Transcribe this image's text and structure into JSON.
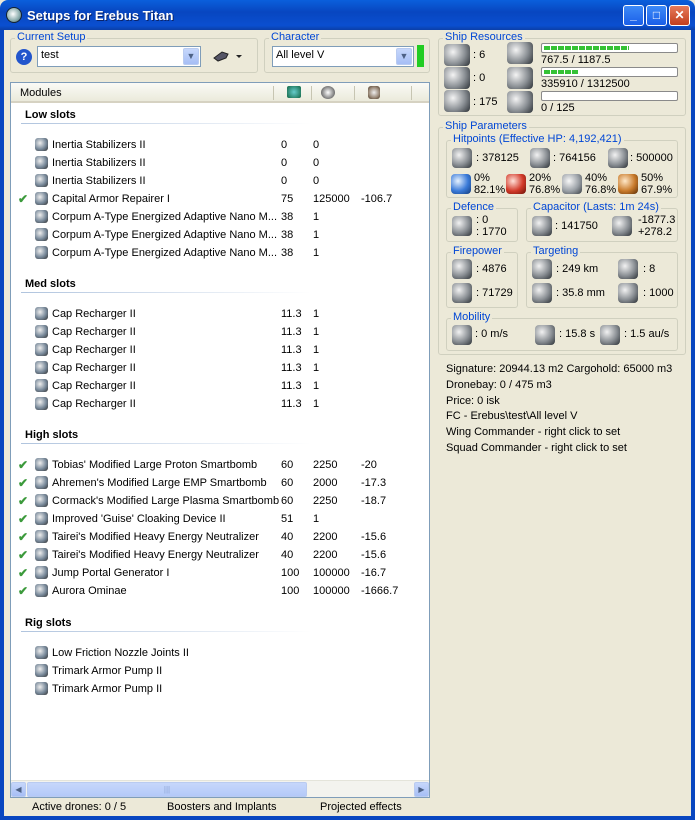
{
  "window": {
    "title": "Setups for Erebus Titan"
  },
  "current_setup": {
    "label": "Current Setup",
    "value": "test"
  },
  "character": {
    "label": "Character",
    "value": "All level V",
    "status_color": "#22cc22"
  },
  "modules_header": {
    "label": "Modules"
  },
  "sections": [
    {
      "title": "Low slots",
      "rows": [
        {
          "check": "",
          "name": "Inertia Stabilizers II",
          "c1": "0",
          "c2": "0",
          "c3": ""
        },
        {
          "check": "",
          "name": "Inertia Stabilizers II",
          "c1": "0",
          "c2": "0",
          "c3": ""
        },
        {
          "check": "",
          "name": "Inertia Stabilizers II",
          "c1": "0",
          "c2": "0",
          "c3": ""
        },
        {
          "check": "✔",
          "name": "Capital Armor Repairer I",
          "c1": "75",
          "c2": "125000",
          "c3": "-106.7"
        },
        {
          "check": "",
          "name": "Corpum A-Type Energized Adaptive Nano M...",
          "c1": "38",
          "c2": "1",
          "c3": ""
        },
        {
          "check": "",
          "name": "Corpum A-Type Energized Adaptive Nano M...",
          "c1": "38",
          "c2": "1",
          "c3": ""
        },
        {
          "check": "",
          "name": "Corpum A-Type Energized Adaptive Nano M...",
          "c1": "38",
          "c2": "1",
          "c3": ""
        }
      ]
    },
    {
      "title": "Med slots",
      "rows": [
        {
          "check": "",
          "name": "Cap Recharger II",
          "c1": "11.3",
          "c2": "1",
          "c3": ""
        },
        {
          "check": "",
          "name": "Cap Recharger II",
          "c1": "11.3",
          "c2": "1",
          "c3": ""
        },
        {
          "check": "",
          "name": "Cap Recharger II",
          "c1": "11.3",
          "c2": "1",
          "c3": ""
        },
        {
          "check": "",
          "name": "Cap Recharger II",
          "c1": "11.3",
          "c2": "1",
          "c3": ""
        },
        {
          "check": "",
          "name": "Cap Recharger II",
          "c1": "11.3",
          "c2": "1",
          "c3": ""
        },
        {
          "check": "",
          "name": "Cap Recharger II",
          "c1": "11.3",
          "c2": "1",
          "c3": ""
        }
      ]
    },
    {
      "title": "High slots",
      "rows": [
        {
          "check": "✔",
          "name": "Tobias' Modified Large Proton Smartbomb",
          "c1": "60",
          "c2": "2250",
          "c3": "-20"
        },
        {
          "check": "✔",
          "name": "Ahremen's Modified Large EMP Smartbomb",
          "c1": "60",
          "c2": "2000",
          "c3": "-17.3"
        },
        {
          "check": "✔",
          "name": "Cormack's Modified Large Plasma Smartbomb",
          "c1": "60",
          "c2": "2250",
          "c3": "-18.7"
        },
        {
          "check": "✔",
          "name": "Improved 'Guise' Cloaking Device II",
          "c1": "51",
          "c2": "1",
          "c3": ""
        },
        {
          "check": "✔",
          "name": "Tairei's Modified Heavy Energy Neutralizer",
          "c1": "40",
          "c2": "2200",
          "c3": "-15.6"
        },
        {
          "check": "✔",
          "name": "Tairei's Modified Heavy Energy Neutralizer",
          "c1": "40",
          "c2": "2200",
          "c3": "-15.6"
        },
        {
          "check": "✔",
          "name": "Jump Portal Generator I",
          "c1": "100",
          "c2": "100000",
          "c3": "-16.7"
        },
        {
          "check": "✔",
          "name": "Aurora Ominae",
          "c1": "100",
          "c2": "100000",
          "c3": "-1666.7"
        }
      ]
    },
    {
      "title": "Rig slots",
      "rows": [
        {
          "check": "",
          "name": "Low Friction Nozzle Joints II",
          "c1": "",
          "c2": "",
          "c3": ""
        },
        {
          "check": "",
          "name": "Trimark Armor Pump II",
          "c1": "",
          "c2": "",
          "c3": ""
        },
        {
          "check": "",
          "name": "Trimark Armor Pump II",
          "c1": "",
          "c2": "",
          "c3": ""
        }
      ]
    }
  ],
  "statusbar": {
    "drones": "Active drones: 0 / 5",
    "boosters": "Boosters and Implants",
    "projected": "Projected effects"
  },
  "ship_resources": {
    "label": "Ship Resources",
    "turret": ": 6",
    "launcher": ": 0",
    "drone_bw": ": 175",
    "cpu_text": "767.5 / 1187.5",
    "cpu_fraction": 0.646,
    "pg_text": "335910 / 1312500",
    "pg_fraction": 0.256,
    "calib_text": "0 / 125",
    "calib_fraction": 0.0
  },
  "ship_parameters": {
    "label": "Ship Parameters",
    "hitpoints": {
      "label": "Hitpoints (Effective HP: 4,192,421)",
      "shield": ": 378125",
      "armor": ": 764156",
      "structure": ": 500000",
      "resists": [
        {
          "icon": "em-resist-icon",
          "value": "0%",
          "value2": "82.1%"
        },
        {
          "icon": "thermal-resist-icon",
          "value": "20%",
          "value2": "76.8%"
        },
        {
          "icon": "kinetic-resist-icon",
          "value": "40%",
          "value2": "76.8%"
        },
        {
          "icon": "explosive-resist-icon",
          "value": "50%",
          "value2": "67.9%"
        }
      ]
    },
    "defence": {
      "label": "Defence",
      "v1": ": 0",
      "v2": ": 1770"
    },
    "capacitor": {
      "label": "Capacitor (Lasts: 1m 24s)",
      "capacity": ": 141750",
      "delta1": "-1877.3",
      "delta2": "+278.2"
    },
    "firepower": {
      "label": "Firepower",
      "v1": ": 4876",
      "v2": ": 71729"
    },
    "targeting": {
      "label": "Targeting",
      "range": ": 249 km",
      "max_targets": ": 8",
      "scan_res": ": 35.8 mm",
      "sensor": ": 1000"
    },
    "mobility": {
      "label": "Mobility",
      "speed": ": 0 m/s",
      "align": ": 15.8 s",
      "warp": ": 1.5 au/s"
    }
  },
  "info_lines": [
    "Signature: 20944.13 m2  Cargohold: 65000 m3",
    "Dronebay: 0 / 475 m3",
    "Price: 0 isk",
    "FC - Erebus\\test\\All level V",
    "Wing Commander - right click to set",
    "Squad Commander - right click to set"
  ]
}
